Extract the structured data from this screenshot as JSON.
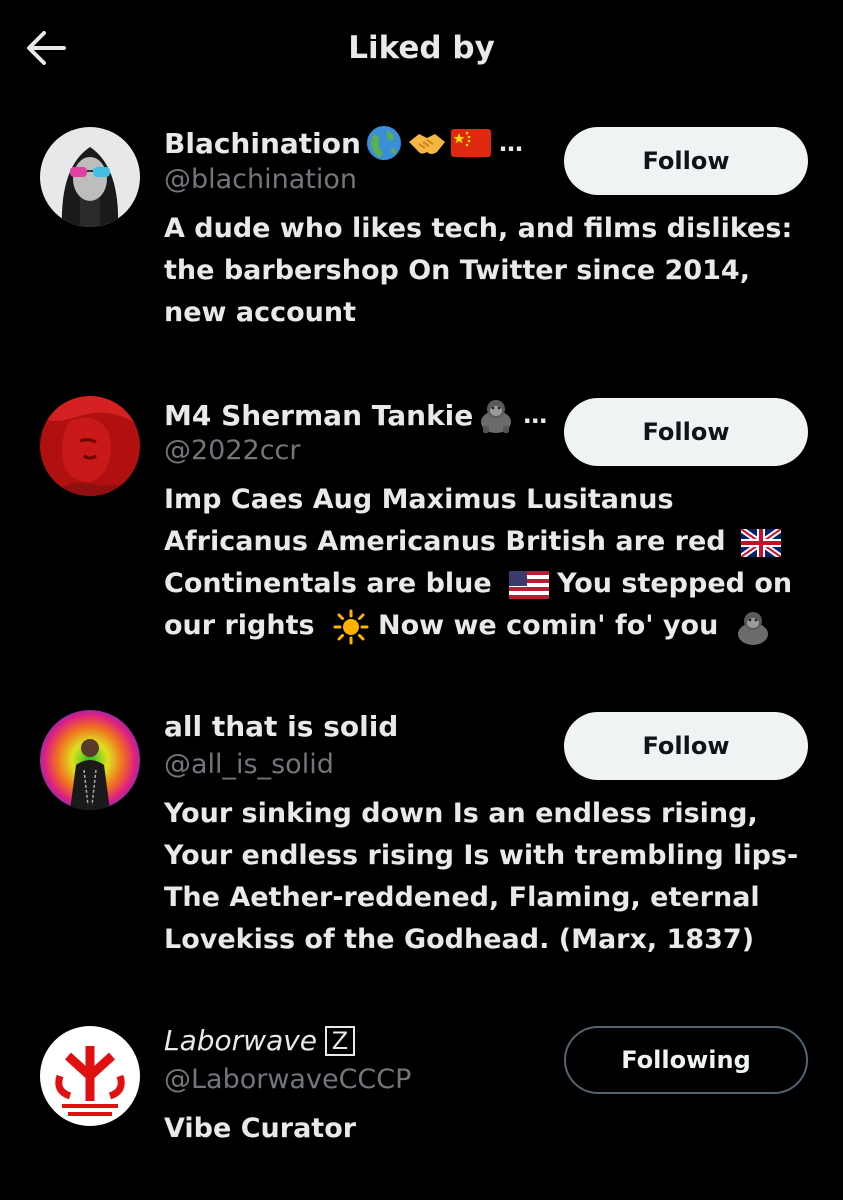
{
  "header": {
    "title": "Liked by"
  },
  "users": [
    {
      "name": "Blachination",
      "handle": "@blachination",
      "bio": "A dude who likes tech, and films dislikes: the barbershop On Twitter since 2014, new account",
      "button": "Follow",
      "name_icons": [
        "globe-icon",
        "handshake-icon",
        "china-flag-icon"
      ]
    },
    {
      "name": "M4 Sherman Tankie",
      "handle": "@2022ccr",
      "bio_parts": [
        "Imp Caes Aug Maximus Lusitanus",
        "Africanus Americanus British are red",
        "Continentals are blue",
        "You stepped on",
        "our rights",
        "Now we comin' fo' you"
      ],
      "button": "Follow",
      "name_icons": [
        "gorilla-icon"
      ]
    },
    {
      "name": "all that is solid",
      "handle": "@all_is_solid",
      "bio": "Your sinking down Is an endless rising, Your endless rising Is with trembling lips- The Aether-reddened, Flaming, eternal Lovekiss of the Godhead. (Marx, 1837)",
      "button": "Follow"
    },
    {
      "name": "Laborwave",
      "name_badge": "Z",
      "handle": "@LaborwaveCCCP",
      "bio": "Vibe Curator",
      "button": "Following"
    }
  ],
  "ellipsis": "…",
  "colors": {
    "background": "#000000",
    "text": "#e7e9ea",
    "secondary": "#71767b",
    "button_bg": "#eff3f4"
  }
}
